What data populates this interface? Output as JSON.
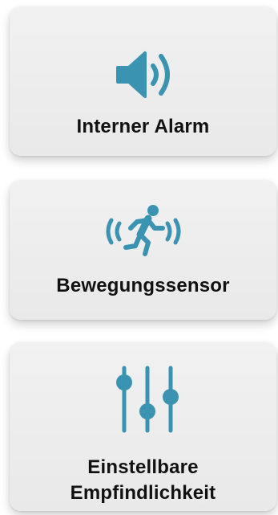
{
  "accent_color": "#3a93b1",
  "features": [
    {
      "icon": "speaker-icon",
      "label_lines": [
        "Interner Alarm"
      ]
    },
    {
      "icon": "running-person-icon",
      "label_lines": [
        "Bewegungssensor"
      ]
    },
    {
      "icon": "sliders-icon",
      "label_lines": [
        "Einstellbare",
        "Empfindlichkeit"
      ]
    }
  ]
}
